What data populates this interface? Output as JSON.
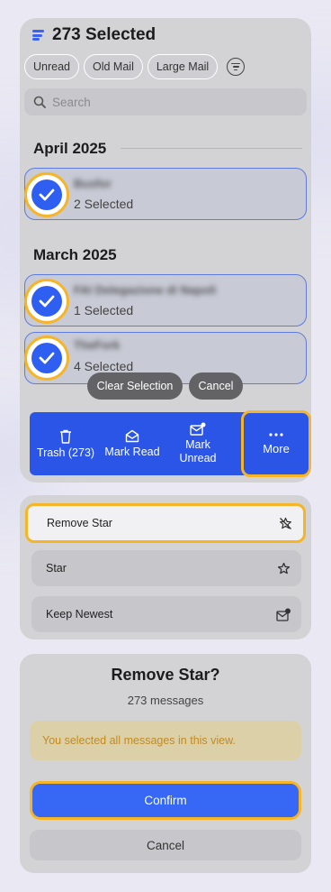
{
  "header": {
    "title": "273 Selected"
  },
  "filters": [
    "Unread",
    "Old Mail",
    "Large Mail"
  ],
  "search": {
    "placeholder": "Search"
  },
  "sections": [
    {
      "title": "April 2025",
      "groups": [
        {
          "sender": "Busfor",
          "count": "2 Selected"
        }
      ]
    },
    {
      "title": "March 2025",
      "groups": [
        {
          "sender": "FAI Delegazione di Napoli",
          "count": "1 Selected"
        },
        {
          "sender": "TheFork",
          "count": "4 Selected"
        }
      ]
    }
  ],
  "selection_actions": {
    "clear": "Clear Selection",
    "cancel": "Cancel"
  },
  "action_bar": {
    "trash": "Trash (273)",
    "mark_read": "Mark Read",
    "mark_unread": "Mark Unread",
    "more": "More"
  },
  "more_menu": [
    {
      "label": "Remove Star",
      "icon": "star-slash-icon"
    },
    {
      "label": "Star",
      "icon": "star-icon"
    },
    {
      "label": "Keep Newest",
      "icon": "mail-badge-icon"
    }
  ],
  "dialog": {
    "title": "Remove Star?",
    "subtitle": "273 messages",
    "notice": "You selected all messages in this view.",
    "confirm": "Confirm",
    "cancel": "Cancel"
  },
  "colors": {
    "accent": "#2b55e6",
    "highlight": "#f6b526",
    "notice_text": "#c08b22"
  }
}
